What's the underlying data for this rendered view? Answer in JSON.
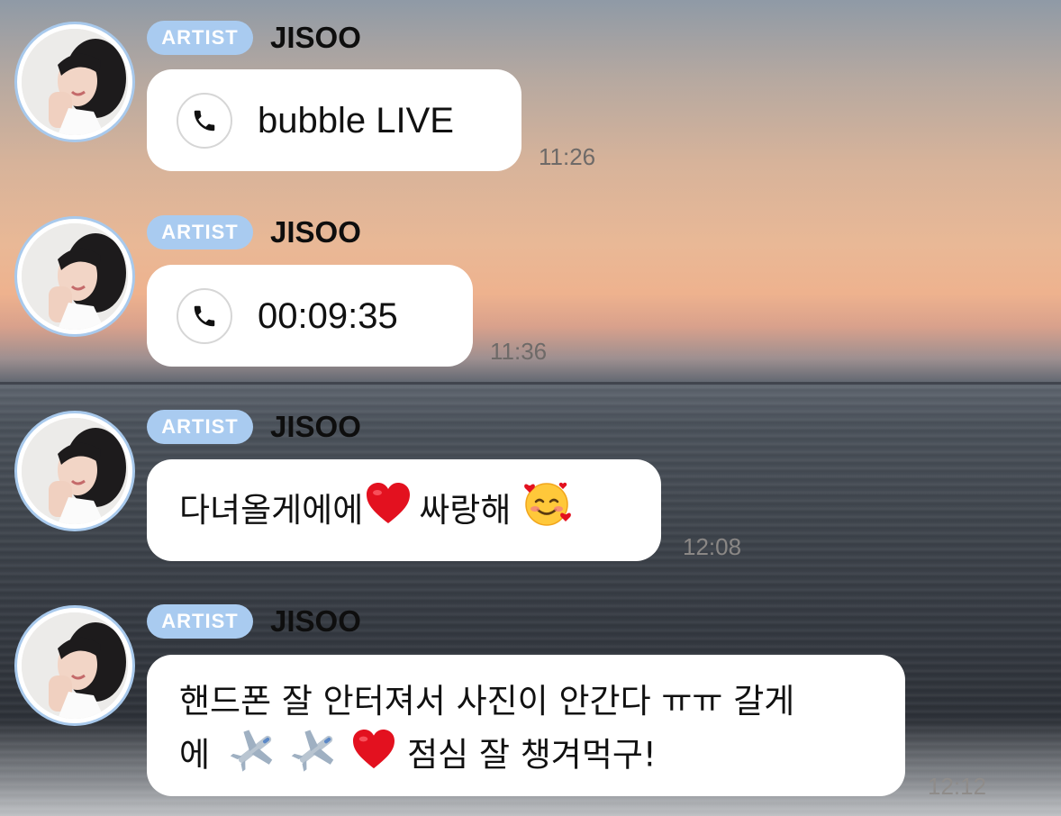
{
  "messages": [
    {
      "badge": "ARTIST",
      "sender": "JISOO",
      "type": "call",
      "call_icon": "phone-icon",
      "text": "bubble LIVE",
      "time": "11:26"
    },
    {
      "badge": "ARTIST",
      "sender": "JISOO",
      "type": "call",
      "call_icon": "phone-icon",
      "text": "00:09:35",
      "time": "11:36"
    },
    {
      "badge": "ARTIST",
      "sender": "JISOO",
      "type": "text",
      "text_parts": [
        "다녀올게에에",
        "싸랑해"
      ],
      "emoji": [
        "red-heart-emoji",
        "smiling-face-with-hearts-emoji"
      ],
      "time": "12:08"
    },
    {
      "badge": "ARTIST",
      "sender": "JISOO",
      "type": "text",
      "line1": "핸드폰 잘 안터져서 사진이 안간다 ㅠㅠ 갈게",
      "line2_start": "에",
      "line2_end": "점심 잘 챙겨먹구!",
      "emoji": [
        "airplane-emoji",
        "airplane-emoji",
        "red-heart-emoji"
      ],
      "time": "12:12"
    }
  ],
  "colors": {
    "badge_bg": "#a9cbf0",
    "avatar_ring": "#a8c9ec",
    "bubble_bg": "#ffffff",
    "heart": "#e3111f"
  }
}
